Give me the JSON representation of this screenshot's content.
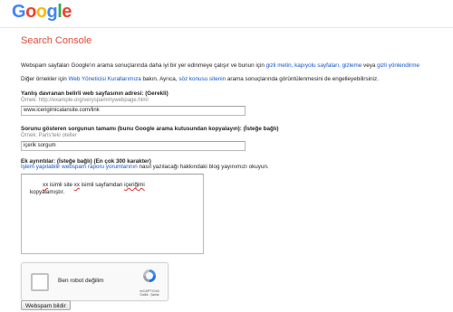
{
  "header": {
    "logo_letters": [
      "G",
      "o",
      "o",
      "g",
      "l",
      "e"
    ],
    "product_title": "Search Console"
  },
  "intro": {
    "text_before": "Webspam sayfaları Google'ın arama sonuçlarında daha iyi bir yer edinmeye çalışır ve bunun için ",
    "link1": "gizli metin, kapıyolu sayfaları,",
    "link2": "gizleme",
    "text_mid": " veya ",
    "link3": "gizli yönlendirme",
    "line2_before": "Diğer örnekler için ",
    "line2_link1": "Web Yöneticisi Kurallarımıza",
    "line2_mid": " bakın. Ayrıca, ",
    "line2_link2": "söz konusu sitenin",
    "line2_after": " arama sonuçlarında görüntülenmesini de engelleyebilirsiniz."
  },
  "form": {
    "url_label": "Yanlış davranan belirli web sayfasının adresi: (Gerekli)",
    "url_example": "Örnek: http://example.org/veryspammywebpage.html",
    "url_value": "www.icerigimicalansite.com/link",
    "query_label": "Sorunu gösteren sorgunun tamamı (bunu Google arama kutusundan kopyalayın): (İsteğe bağlı)",
    "query_example": "Örnek: Paris'teki oteller",
    "query_value": "içerik sorgum",
    "details_label": "Ek ayrıntılar: (İsteğe bağlı) (En çok 300 karakter)",
    "details_note_link": "İşlem yapılabilir webspam raporu yorumlarının",
    "details_note_text": " nasıl yazılacağı hakkındaki blog yayınımızı okuyun.",
    "details_text_part1": "xx",
    "details_text_part2": " isimli site ",
    "details_text_part3": "xx",
    "details_text_part4": " isimli sayfamdan ",
    "details_text_part5": "içeriğimi",
    "details_text_line2": "kopyalamıştır."
  },
  "captcha": {
    "label": "Ben robot değilim",
    "brand": "reCAPTCHA",
    "links": "Gizlilik - Şartlar"
  },
  "submit": {
    "label": "Webspam bildir"
  }
}
